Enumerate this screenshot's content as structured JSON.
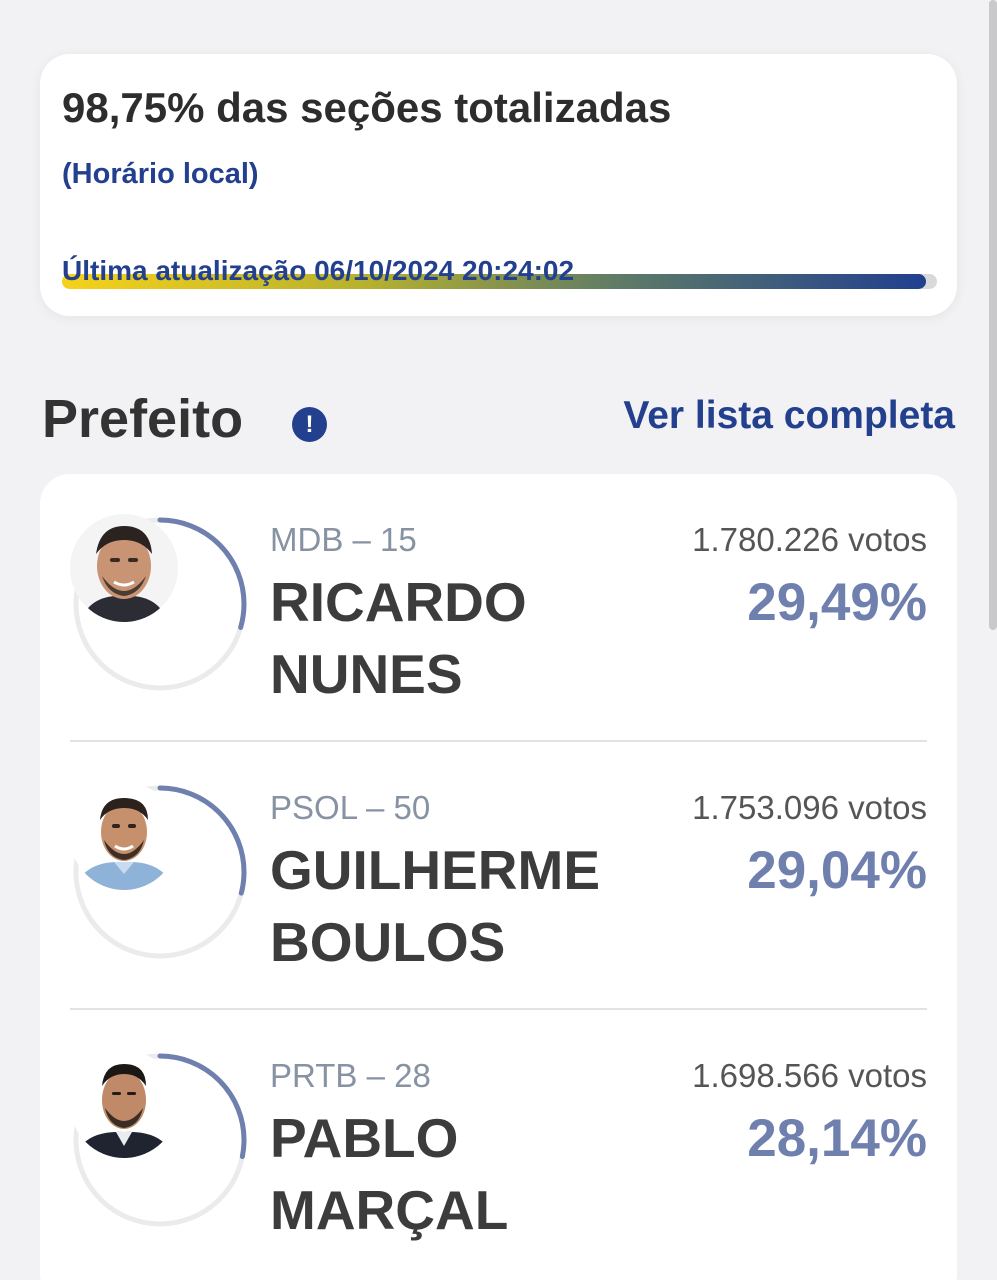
{
  "status": {
    "title": "98,75% das seções totalizadas",
    "subtitle": "(Horário local)",
    "progress_percent": 98.75,
    "updated": "Última atualização 06/10/2024 20:24:02"
  },
  "section": {
    "title": "Prefeito",
    "info_icon": "!",
    "see_all": "Ver lista completa"
  },
  "candidates": [
    {
      "party": "MDB – 15",
      "name_line1": "RICARDO",
      "name_line2": "NUNES",
      "votes": "1.780.226 votos",
      "percent": "29,49%",
      "ring_fraction": 0.2949
    },
    {
      "party": "PSOL – 50",
      "name_line1": "GUILHERME",
      "name_line2": "BOULOS",
      "votes": "1.753.096 votos",
      "percent": "29,04%",
      "ring_fraction": 0.2904
    },
    {
      "party": "PRTB – 28",
      "name_line1": "PABLO",
      "name_line2": "MARÇAL",
      "votes": "1.698.566 votos",
      "percent": "28,14%",
      "ring_fraction": 0.2814
    }
  ],
  "colors": {
    "accent": "#23408e",
    "percent": "#6f7fae",
    "ring_track": "#ebebee"
  }
}
